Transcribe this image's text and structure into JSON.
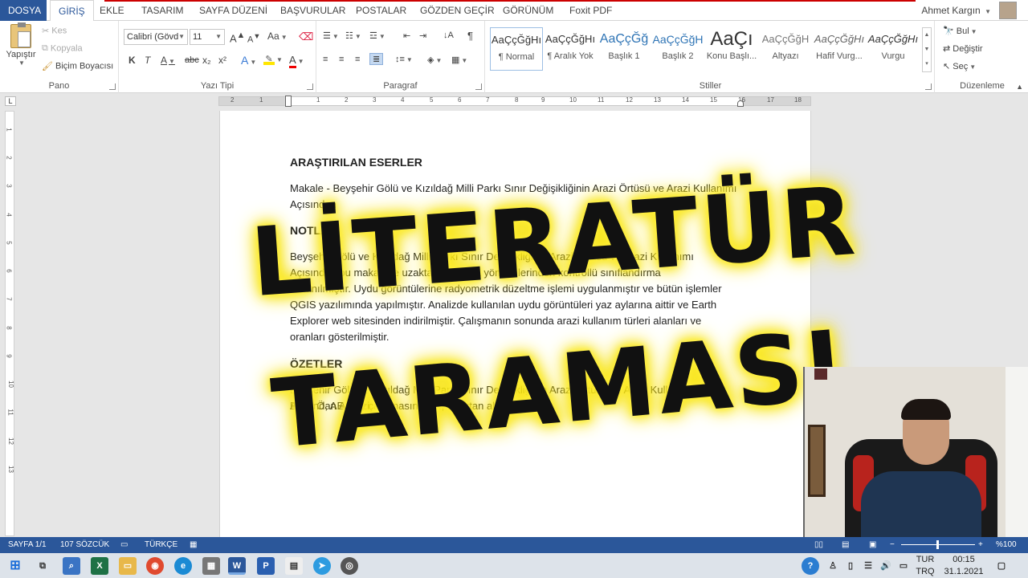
{
  "tabs": {
    "file": "DOSYA",
    "home": "GİRİŞ",
    "insert": "EKLE",
    "design": "TASARIM",
    "layout": "SAYFA DÜZENİ",
    "references": "BAŞVURULAR",
    "mailings": "POSTALAR",
    "review": "GÖZDEN GEÇİR",
    "view": "GÖRÜNÜM",
    "foxit": "Foxit PDF"
  },
  "user": {
    "name": "Ahmet Kargın"
  },
  "clipboard": {
    "paste": "Yapıştır",
    "cut": "Kes",
    "copy": "Kopyala",
    "format_painter": "Biçim Boyacısı",
    "label": "Pano"
  },
  "font": {
    "family": "Calibri (Gövd",
    "size": "11",
    "grow": "A",
    "shrink": "A",
    "case": "Aa",
    "bold": "K",
    "italic": "T",
    "underline": "A",
    "strike": "abc",
    "subscript": "x₂",
    "superscript": "x²",
    "effects": "A",
    "color": "A",
    "label": "Yazı Tipi"
  },
  "paragraph": {
    "label": "Paragraf",
    "pilcrow": "¶"
  },
  "styles": {
    "label": "Stiller",
    "items": [
      {
        "preview": "AaÇçĞğHı",
        "name": "¶ Normal"
      },
      {
        "preview": "AaÇçĞğHı",
        "name": "¶ Aralık Yok"
      },
      {
        "preview": "AaÇçĞğ",
        "name": "Başlık 1"
      },
      {
        "preview": "AaÇçĞğH",
        "name": "Başlık 2"
      },
      {
        "preview": "AaÇı",
        "name": "Konu Başlı..."
      },
      {
        "preview": "AaÇçĞğH",
        "name": "Altyazı"
      },
      {
        "preview": "AaÇçĞğHı",
        "name": "Hafif Vurg..."
      },
      {
        "preview": "AaÇçĞğHı",
        "name": "Vurgu"
      }
    ]
  },
  "editing": {
    "find": "Bul",
    "replace": "Değiştir",
    "select": "Seç",
    "label": "Düzenleme"
  },
  "ruler": {
    "corner": "L",
    "ticks": [
      "2",
      "1",
      "1",
      "2",
      "3",
      "4",
      "5",
      "6",
      "7",
      "8",
      "9",
      "10",
      "11",
      "12",
      "13",
      "14",
      "15",
      "16",
      "17",
      "18"
    ],
    "vticks": [
      "1",
      "2",
      "3",
      "4",
      "5",
      "6",
      "7",
      "8",
      "9",
      "10",
      "11",
      "12",
      "13"
    ]
  },
  "document": {
    "heading1": "ARAŞTIRILAN ESERLER",
    "article_line1": "Makale - Beyşehir Gölü ve Kızıldağ Milli Parkı Sınır Değişikliğinin Arazi Örtüsü ve Arazi Kullanımı",
    "article_line2": "Açısından",
    "heading2": "NOTLAR",
    "notes_l1": "Beyşehir Gölü ve Kızıldağ Milli Parkı Sınır Değişikliğinin Arazi Örtüsü ve Arazi Kullanımı",
    "notes_l2": "Açısından bu makalede uzaktan algılama yöntemlerinden kontrollü sınıflandırma",
    "notes_l3": "kullanılmıştır. Uydu görüntülerine radyometrik düzeltme işlemi uygulanmıştır ve bütün işlemler",
    "notes_l4": "QGIS yazılımında yapılmıştır. Analizde kullanılan uydu görüntüleri yaz aylarına aittir ve Earth",
    "notes_l5": "Explorer web sitesinden indirilmiştir. Çalışmanın sonunda arazi kullanım türleri alanları ve",
    "notes_l6": "oranları gösterilmiştir.",
    "heading3": "ÖZETLER",
    "summary_l1": "Beyşehir Gölü ve Kızıldağ Milli Parkı Sınır Değişikliğinin Arazi Örtüsü ve Arazi Kullanımı Açısından Analizi",
    "summary_l2": "Bucü Ö, AE (2..) çalışmasında ..., uzaktan algılama"
  },
  "overlay": {
    "line1": "LİTERATÜR",
    "line2": "TARAMASI"
  },
  "statusbar": {
    "page": "SAYFA 1/1",
    "words": "107 SÖZCÜK",
    "language": "TÜRKÇE",
    "zoom": "%100"
  },
  "taskbar": {
    "lang_top": "TUR",
    "lang_bottom": "TRQ",
    "time": "00:15",
    "date": "31.1.2021"
  },
  "colors": {
    "accent": "#2b579a",
    "overlay_glow": "#ffef3a"
  }
}
